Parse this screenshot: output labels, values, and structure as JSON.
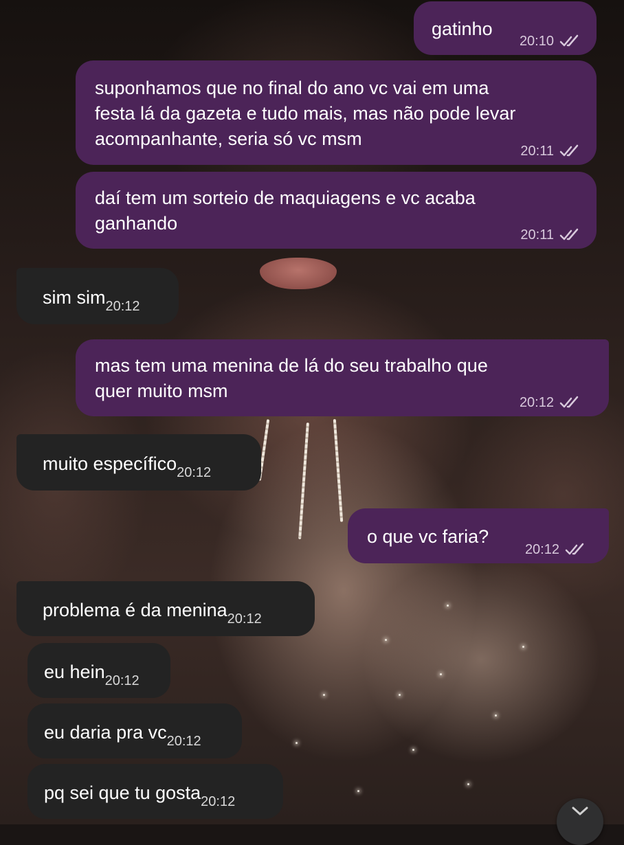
{
  "chat": {
    "messages": [
      {
        "direction": "outgoing",
        "text": "gatinho",
        "time": "20:10",
        "status": "read"
      },
      {
        "direction": "outgoing",
        "lines": [
          "suponhamos que no final do ano vc vai em uma",
          "festa lá da gazeta e tudo mais, mas não pode levar",
          "acompanhante, seria só vc msm"
        ],
        "time": "20:11",
        "status": "read"
      },
      {
        "direction": "outgoing",
        "lines": [
          "daí tem um sorteio de maquiagens e vc acaba",
          "ganhando"
        ],
        "time": "20:11",
        "status": "read"
      },
      {
        "direction": "incoming",
        "text": "sim sim",
        "time": "20:12"
      },
      {
        "direction": "outgoing",
        "lines": [
          "mas tem uma menina de lá do seu trabalho que",
          "quer muito msm"
        ],
        "time": "20:12",
        "status": "read"
      },
      {
        "direction": "incoming",
        "text": "muito específico",
        "time": "20:12"
      },
      {
        "direction": "outgoing",
        "text": "o que vc faria?",
        "time": "20:12",
        "status": "read"
      },
      {
        "direction": "incoming",
        "text": "problema é da menina",
        "time": "20:12"
      },
      {
        "direction": "incoming",
        "text": "eu hein",
        "time": "20:12"
      },
      {
        "direction": "incoming",
        "text": "eu daria pra vc",
        "time": "20:12"
      },
      {
        "direction": "incoming",
        "text": "pq sei que tu gosta",
        "time": "20:12"
      }
    ]
  },
  "colors": {
    "outgoing_bubble": "#4c2458",
    "incoming_bubble": "#232323",
    "text": "#ffffff",
    "meta_text": "#d8c9dc"
  },
  "icons": {
    "read_receipt": "double-check-icon",
    "scroll_down": "chevron-down-icon"
  }
}
